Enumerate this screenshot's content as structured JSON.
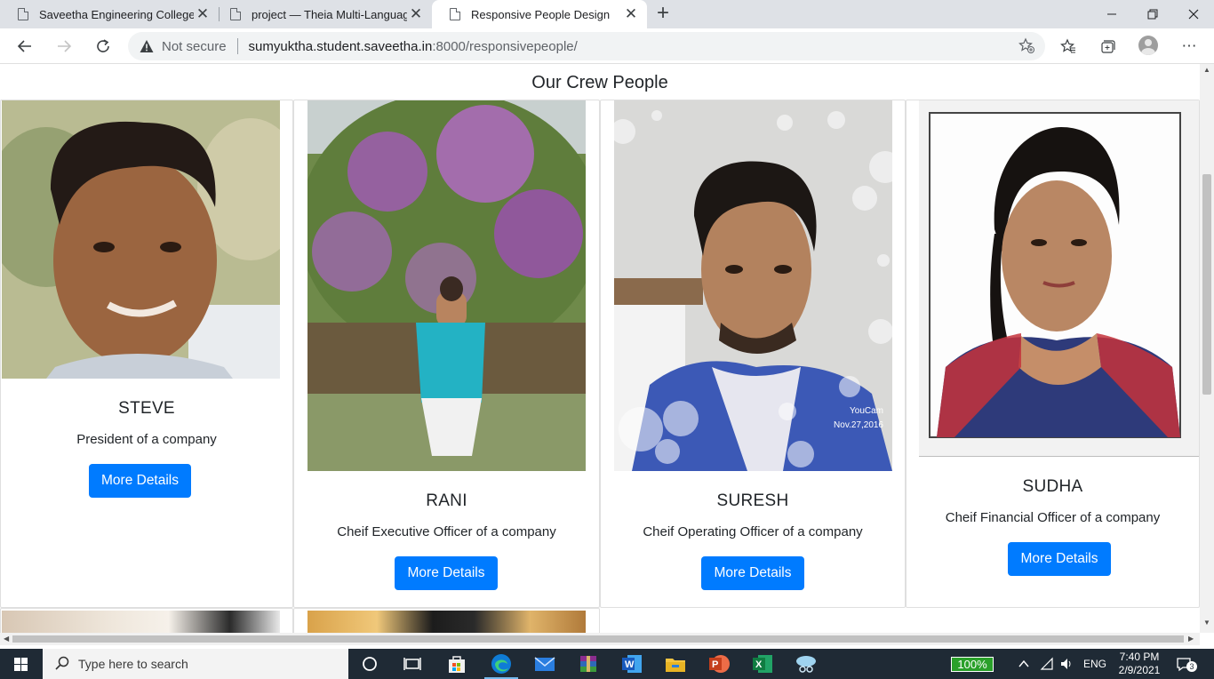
{
  "browser": {
    "tabs": [
      {
        "title": "Saveetha Engineering College",
        "active": false
      },
      {
        "title": "project — Theia Multi-Language",
        "active": false
      },
      {
        "title": "Responsive People Design",
        "active": true
      }
    ],
    "security_label": "Not secure",
    "url_host": "sumyuktha.student.saveetha.in",
    "url_rest": ":8000/responsivepeople/"
  },
  "page": {
    "title": "Our Crew People",
    "people": [
      {
        "name": "STEVE",
        "role": "President of a company",
        "button": "More Details"
      },
      {
        "name": "RANI",
        "role": "Cheif Executive Officer of a company",
        "button": "More Details"
      },
      {
        "name": "SURESH",
        "role": "Cheif Operating Officer of a company",
        "button": "More Details"
      },
      {
        "name": "SUDHA",
        "role": "Cheif Financial Officer of a company",
        "button": "More Details"
      }
    ],
    "photo_watermark": [
      "YouCam",
      "Nov.27,2016"
    ]
  },
  "taskbar": {
    "search_placeholder": "Type here to search",
    "battery": "100%",
    "language": "ENG",
    "time": "7:40 PM",
    "date": "2/9/2021",
    "notifications": "3"
  },
  "icons": [
    "page-icon",
    "close-icon",
    "plus-icon",
    "minimize-icon",
    "restore-icon",
    "back-icon",
    "forward-icon",
    "refresh-icon",
    "warning-icon",
    "add-favorite-icon",
    "favorites-icon",
    "collections-icon",
    "profile-icon",
    "more-icon",
    "windows-icon",
    "search-icon",
    "cortana-icon",
    "task-view-icon",
    "store-icon",
    "edge-icon",
    "mail-icon",
    "winrar-icon",
    "word-icon",
    "explorer-icon",
    "powerpoint-icon",
    "excel-icon",
    "chevron-up-icon",
    "wifi-icon",
    "volume-icon",
    "notification-icon"
  ],
  "colors": {
    "button": "#007bff",
    "taskbar": "#1f2a35",
    "tabstrip": "#dee1e6"
  }
}
